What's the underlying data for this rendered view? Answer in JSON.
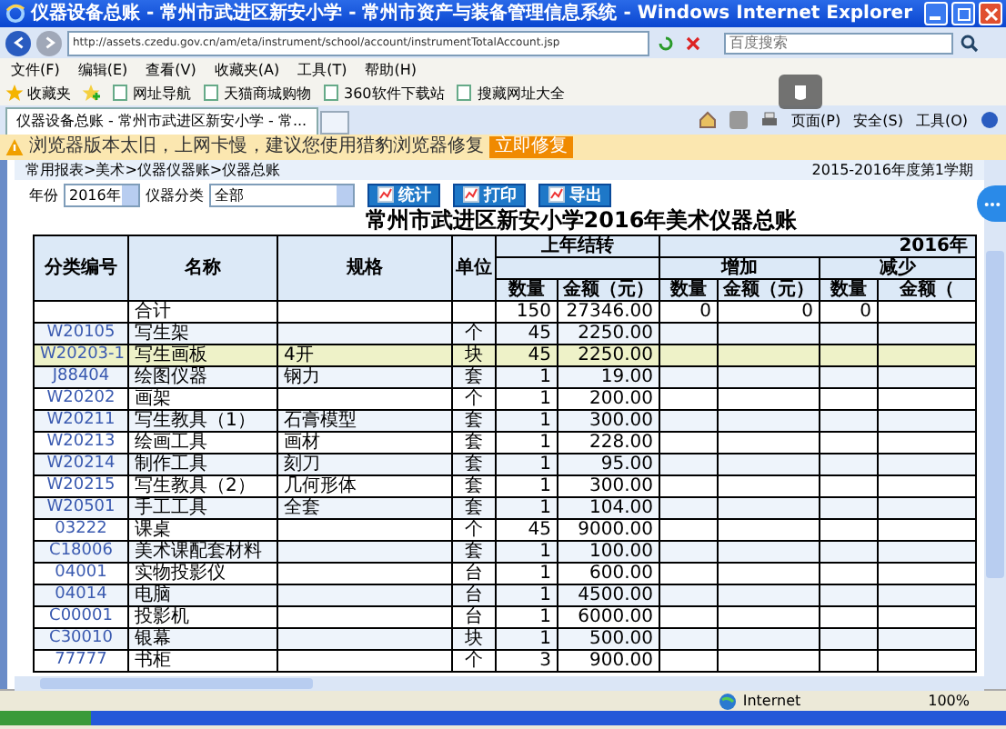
{
  "window": {
    "title": "仪器设备总账 - 常州市武进区新安小学 - 常州市资产与装备管理信息系统 - Windows Internet Explorer"
  },
  "address_bar": {
    "url": "http://assets.czedu.gov.cn/am/eta/instrument/school/account/instrumentTotalAccount.jsp",
    "search_placeholder": "百度搜索"
  },
  "menu": [
    "文件(F)",
    "编辑(E)",
    "查看(V)",
    "收藏夹(A)",
    "工具(T)",
    "帮助(H)"
  ],
  "favorites": {
    "label": "收藏夹",
    "items": [
      "网址导航",
      "天猫商城购物",
      "360软件下载站",
      "搜藏网址大全"
    ]
  },
  "tabs": [
    {
      "label": "仪器设备总账 - 常州市武进区新安小学 - 常...",
      "selected": true
    }
  ],
  "commands": [
    "页面(P)",
    "安全(S)",
    "工具(O)"
  ],
  "warning": {
    "text": "浏览器版本太旧，上网卡慢，建议您使用猎豹浏览器修复",
    "button": "立即修复"
  },
  "page": {
    "breadcrumb": "常用报表>美术>仪器仪器账>仪器总账",
    "term": "2015-2016年度第1学期",
    "filters": {
      "year_label": "年份",
      "year": "2016年",
      "category_label": "仪器分类",
      "category": "全部"
    },
    "buttons": [
      "统计",
      "打印",
      "导出"
    ],
    "title": "常州市武进区新安小学2016年美术仪器总账",
    "table": {
      "headers": {
        "code": "分类编号",
        "name": "名称",
        "spec": "规格",
        "unit": "单位",
        "prev": "上年结转",
        "year": "2016年",
        "increase": "增加",
        "decrease": "减少"
      },
      "sub_headers": [
        "数量",
        "金额（元）",
        "数量",
        "金额（元）",
        "数量",
        "金额（"
      ],
      "rows": [
        {
          "name": "合计",
          "qty": "150",
          "amount": "27346.00",
          "inc_qty": "0",
          "inc_amount": "0",
          "dec_qty": "0",
          "selected": false
        },
        {
          "code": "W20105",
          "name": "写生架",
          "unit": "个",
          "qty": "45",
          "amount": "2250.00",
          "selected": false
        },
        {
          "code": "W20203-1",
          "name": "写生画板",
          "spec": "4开",
          "unit": "块",
          "qty": "45",
          "amount": "2250.00",
          "selected": true
        },
        {
          "code": "J88404",
          "name": "绘图仪器",
          "spec": "钢力",
          "unit": "套",
          "qty": "1",
          "amount": "19.00",
          "selected": false
        },
        {
          "code": "W20202",
          "name": "画架",
          "unit": "个",
          "qty": "1",
          "amount": "200.00",
          "selected": false
        },
        {
          "code": "W20211",
          "name": "写生教具（1）",
          "spec": "石膏模型",
          "unit": "套",
          "qty": "1",
          "amount": "300.00",
          "selected": false
        },
        {
          "code": "W20213",
          "name": "绘画工具",
          "spec": "画材",
          "unit": "套",
          "qty": "1",
          "amount": "228.00",
          "selected": false
        },
        {
          "code": "W20214",
          "name": "制作工具",
          "spec": "刻刀",
          "unit": "套",
          "qty": "1",
          "amount": "95.00",
          "selected": false
        },
        {
          "code": "W20215",
          "name": "写生教具（2）",
          "spec": "几何形体",
          "unit": "套",
          "qty": "1",
          "amount": "300.00",
          "selected": false
        },
        {
          "code": "W20501",
          "name": "手工工具",
          "spec": "全套",
          "unit": "套",
          "qty": "1",
          "amount": "104.00",
          "selected": false
        },
        {
          "code": "03222",
          "name": "课桌",
          "unit": "个",
          "qty": "45",
          "amount": "9000.00",
          "selected": false
        },
        {
          "code": "C18006",
          "name": "美术课配套材料",
          "unit": "套",
          "qty": "1",
          "amount": "100.00",
          "selected": false
        },
        {
          "code": "04001",
          "name": "实物投影仪",
          "unit": "台",
          "qty": "1",
          "amount": "600.00",
          "selected": false
        },
        {
          "code": "04014",
          "name": "电脑",
          "unit": "台",
          "qty": "1",
          "amount": "4500.00",
          "selected": false
        },
        {
          "code": "C00001",
          "name": "投影机",
          "unit": "台",
          "qty": "1",
          "amount": "6000.00",
          "selected": false
        },
        {
          "code": "C30010",
          "name": "银幕",
          "unit": "块",
          "qty": "1",
          "amount": "500.00",
          "selected": false
        },
        {
          "code": "77777",
          "name": "书柜",
          "unit": "个",
          "qty": "3",
          "amount": "900.00",
          "selected": false
        }
      ]
    }
  },
  "status_bar": {
    "zone": "Internet",
    "zoom": "100%"
  }
}
